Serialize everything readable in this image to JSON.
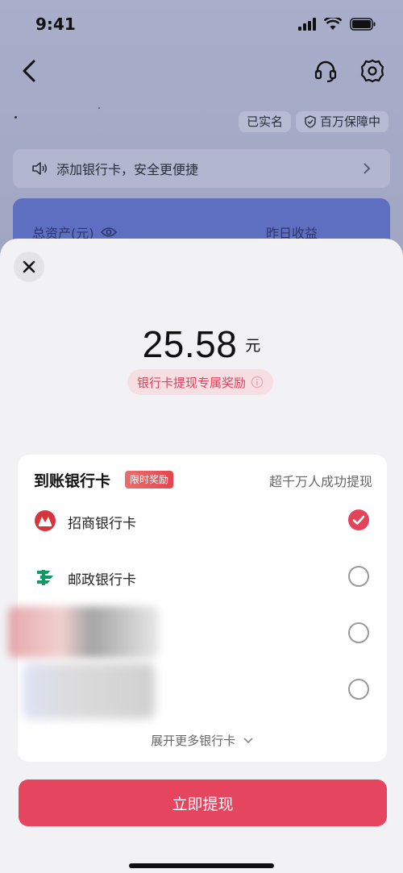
{
  "status_bar": {
    "time": "9:41"
  },
  "background": {
    "tags": {
      "verified": "已实名",
      "guarantee": "百万保障中"
    },
    "notice": {
      "text": "添加银行卡，安全更便捷"
    },
    "assets": {
      "total_label": "总资产(元)",
      "yesterday_label": "昨日收益"
    }
  },
  "sheet": {
    "amount": "25.58",
    "unit": "元",
    "reward_text": "银行卡提现专属奖励",
    "bank_section": {
      "title": "到账银行卡",
      "badge": "限时奖励",
      "subtitle": "超千万人成功提现",
      "banks": [
        {
          "name": "招商银行卡",
          "selected": true,
          "logo": "cmb-logo-icon"
        },
        {
          "name": "邮政银行卡",
          "selected": false,
          "logo": "psbc-logo-icon"
        }
      ],
      "expand_label": "展开更多银行卡"
    },
    "withdraw_button": "立即提现"
  },
  "colors": {
    "accent": "#e64560",
    "card_blue": "#5e6ec0",
    "psbc_green": "#0f9a63"
  }
}
